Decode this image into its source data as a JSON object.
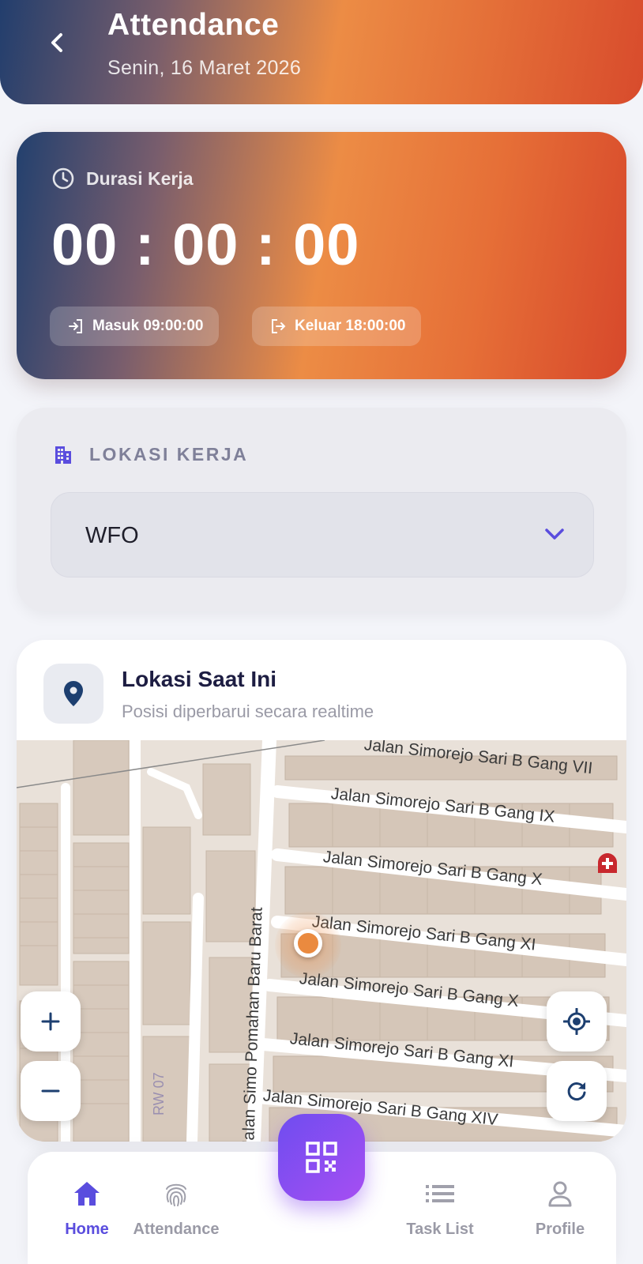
{
  "header": {
    "title": "Attendance",
    "date": "Senin, 16 Maret 2026"
  },
  "duration": {
    "label": "Durasi Kerja",
    "timer": "00 : 00 : 00",
    "check_in": "Masuk 09:00:00",
    "check_out": "Keluar 18:00:00"
  },
  "work_location": {
    "label": "LOKASI KERJA",
    "selected": "WFO"
  },
  "current_location": {
    "title": "Lokasi Saat Ini",
    "subtitle": "Posisi diperbarui secara realtime",
    "streets": {
      "vii": "Jalan Simorejo Sari B Gang VII",
      "ix": "Jalan Simorejo Sari B Gang IX",
      "x": "Jalan Simorejo Sari B Gang X",
      "xi": "Jalan Simorejo Sari B Gang XI",
      "xii": "Jalan Simorejo Sari B Gang X",
      "xiii": "Jalan Simorejo Sari B Gang XI",
      "xiv": "Jalan Simorejo Sari B Gang XIV",
      "vertical": "Jalan Simo Pomahan Baru Barat",
      "rw": "RW 07"
    }
  },
  "nav": {
    "home": "Home",
    "attendance": "Attendance",
    "tasks": "Task List",
    "profile": "Profile"
  },
  "colors": {
    "accent": "#5a4dde",
    "gradient_start": "#22406e",
    "gradient_mid": "#ec8c45",
    "gradient_end": "#d7482b",
    "fab": "#8b4ef1",
    "location_pin": "#ea8a3f"
  }
}
